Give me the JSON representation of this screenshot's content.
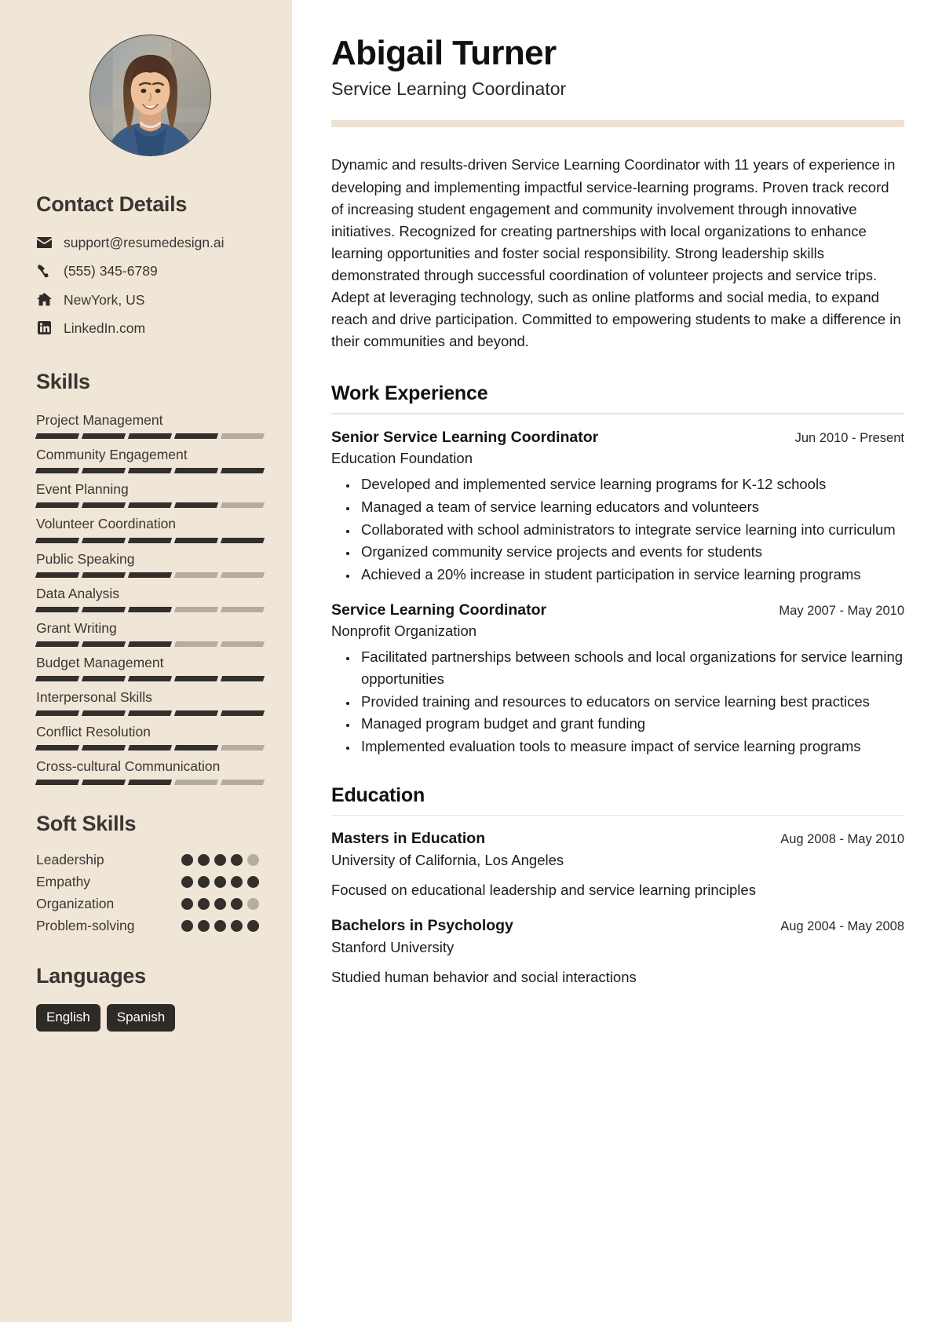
{
  "theme": {
    "sidebar_bg": "#f0e6d8",
    "accent_rule": "#ede2d3",
    "dark": "#332f2a",
    "muted": "#b5aca0"
  },
  "sidebar": {
    "avatar_alt": "profile-photo",
    "contact": {
      "heading": "Contact Details",
      "items": [
        {
          "icon": "envelope-icon",
          "text": "support@resumedesign.ai"
        },
        {
          "icon": "phone-icon",
          "text": "(555) 345-6789"
        },
        {
          "icon": "home-icon",
          "text": "NewYork, US"
        },
        {
          "icon": "linkedin-icon",
          "text": "LinkedIn.com"
        }
      ]
    },
    "skills": {
      "heading": "Skills",
      "max": 5,
      "items": [
        {
          "name": "Project Management",
          "level": 4
        },
        {
          "name": "Community Engagement",
          "level": 5
        },
        {
          "name": "Event Planning",
          "level": 4
        },
        {
          "name": "Volunteer Coordination",
          "level": 5
        },
        {
          "name": "Public Speaking",
          "level": 3
        },
        {
          "name": "Data Analysis",
          "level": 3
        },
        {
          "name": "Grant Writing",
          "level": 3
        },
        {
          "name": "Budget Management",
          "level": 5
        },
        {
          "name": "Interpersonal Skills",
          "level": 5
        },
        {
          "name": "Conflict Resolution",
          "level": 4
        },
        {
          "name": "Cross-cultural Communication",
          "level": 3
        }
      ]
    },
    "soft_skills": {
      "heading": "Soft Skills",
      "max": 5,
      "items": [
        {
          "name": "Leadership",
          "level": 4
        },
        {
          "name": "Empathy",
          "level": 5
        },
        {
          "name": "Organization",
          "level": 4
        },
        {
          "name": "Problem-solving",
          "level": 5
        }
      ]
    },
    "languages": {
      "heading": "Languages",
      "items": [
        "English",
        "Spanish"
      ]
    }
  },
  "main": {
    "name": "Abigail Turner",
    "role": "Service Learning Coordinator",
    "summary": "Dynamic and results-driven Service Learning Coordinator with 11 years of experience in developing and implementing impactful service-learning programs. Proven track record of increasing student engagement and community involvement through innovative initiatives. Recognized for creating partnerships with local organizations to enhance learning opportunities and foster social responsibility. Strong leadership skills demonstrated through successful coordination of volunteer projects and service trips. Adept at leveraging technology, such as online platforms and social media, to expand reach and drive participation. Committed to empowering students to make a difference in their communities and beyond.",
    "work": {
      "heading": "Work Experience",
      "entries": [
        {
          "title": "Senior Service Learning Coordinator",
          "date": "Jun 2010 - Present",
          "org": "Education Foundation",
          "bullets": [
            "Developed and implemented service learning programs for K-12 schools",
            "Managed a team of service learning educators and volunteers",
            "Collaborated with school administrators to integrate service learning into curriculum",
            "Organized community service projects and events for students",
            "Achieved a 20% increase in student participation in service learning programs"
          ]
        },
        {
          "title": "Service Learning Coordinator",
          "date": "May 2007 - May 2010",
          "org": "Nonprofit Organization",
          "bullets": [
            "Facilitated partnerships between schools and local organizations for service learning opportunities",
            "Provided training and resources to educators on service learning best practices",
            "Managed program budget and grant funding",
            "Implemented evaluation tools to measure impact of service learning programs"
          ]
        }
      ]
    },
    "education": {
      "heading": "Education",
      "entries": [
        {
          "title": "Masters in Education",
          "date": "Aug 2008 - May 2010",
          "org": "University of California, Los Angeles",
          "desc": "Focused on educational leadership and service learning principles"
        },
        {
          "title": "Bachelors in Psychology",
          "date": "Aug 2004 - May 2008",
          "org": "Stanford University",
          "desc": "Studied human behavior and social interactions"
        }
      ]
    }
  }
}
